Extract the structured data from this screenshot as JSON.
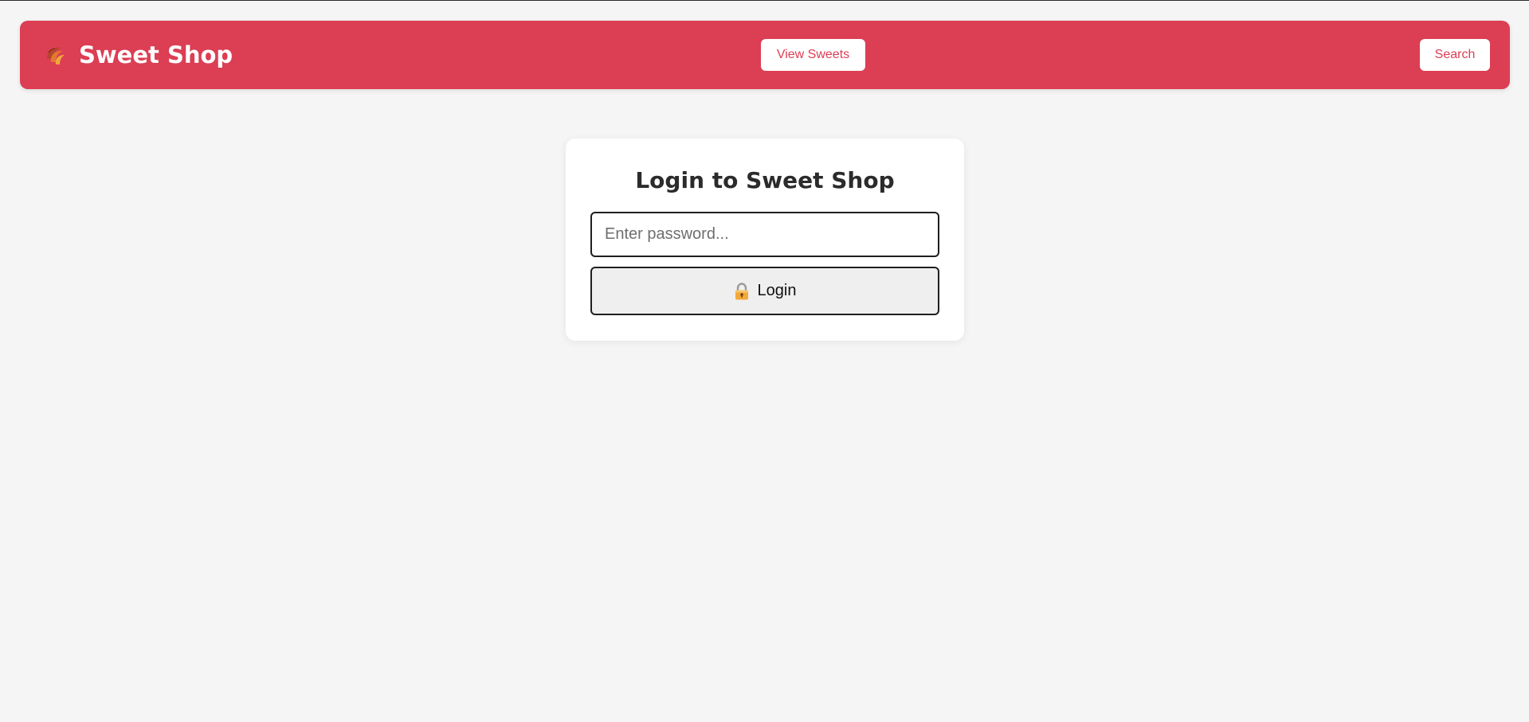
{
  "navbar": {
    "brand_icon": "croissant-icon",
    "brand_title": "Sweet Shop",
    "view_sweets_label": "View Sweets",
    "search_label": "Search"
  },
  "login": {
    "title": "Login to Sweet Shop",
    "password_placeholder": "Enter password...",
    "password_value": "",
    "button_icon": "lock-icon",
    "button_label": "Login"
  },
  "colors": {
    "brand": "#dc3e54",
    "background": "#f5f5f5",
    "card": "#ffffff"
  }
}
